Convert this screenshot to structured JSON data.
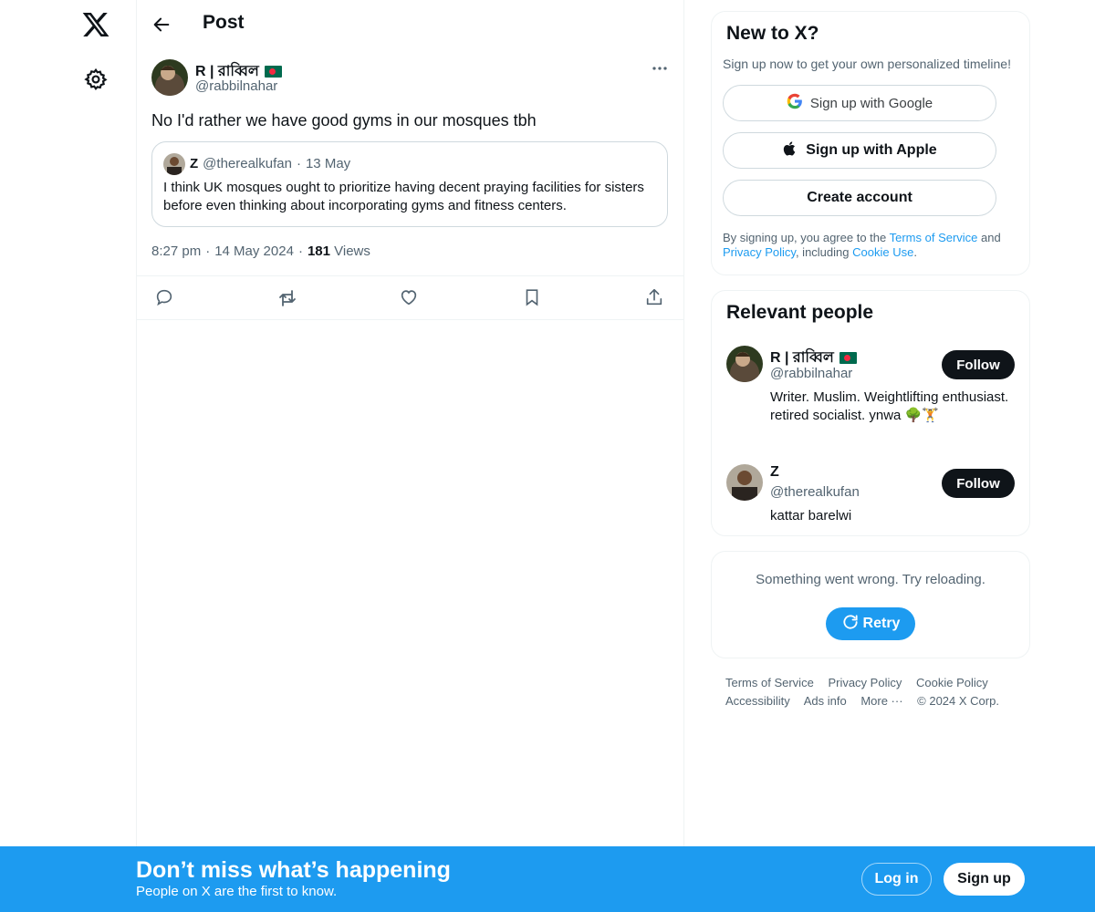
{
  "nav": {
    "logo_icon": "x-logo-icon",
    "settings_icon": "gear-icon"
  },
  "header": {
    "title": "Post",
    "back_icon": "arrow-left-icon"
  },
  "post": {
    "author_name": "R | রাব্বিল",
    "author_handle": "@rabbilnahar",
    "text": "No I'd rather we have good gyms in our mosques tbh",
    "quote": {
      "author_name": "Z",
      "author_handle": "@therealkufan",
      "separator": "·",
      "date": "13 May",
      "text": "I think UK mosques ought to prioritize having decent praying facilities for sisters before even thinking about incorporating gyms and fitness centers."
    },
    "time": "8:27 pm",
    "separator": "·",
    "date": "14 May 2024",
    "views_count": "181",
    "views_label": "Views"
  },
  "signup_card": {
    "title": "New to X?",
    "subtitle": "Sign up now to get your own personalized timeline!",
    "google_label": "Sign up with Google",
    "apple_label": "Sign up with Apple",
    "create_label": "Create account",
    "legal_prefix": "By signing up, you agree to the ",
    "terms_label": "Terms of Service",
    "legal_and": " and ",
    "privacy_label": "Privacy Policy",
    "legal_including": ", including ",
    "cookie_label": "Cookie Use",
    "legal_end": "."
  },
  "relevant": {
    "title": "Relevant people",
    "people": [
      {
        "name": "R | রাব্বিল",
        "handle": "@rabbilnahar",
        "bio": "Writer. Muslim. Weightlifting enthusiast. retired socialist. ynwa 🌳🏋",
        "follow_label": "Follow"
      },
      {
        "name": "Z",
        "handle": "@therealkufan",
        "bio": "kattar barelwi",
        "follow_label": "Follow"
      }
    ]
  },
  "error_card": {
    "message": "Something went wrong. Try reloading.",
    "retry_label": "Retry"
  },
  "footer": {
    "links": [
      "Terms of Service",
      "Privacy Policy",
      "Cookie Policy",
      "Accessibility",
      "Ads info",
      "More ···",
      "© 2024 X Corp."
    ]
  },
  "bottom_bar": {
    "title": "Don’t miss what’s happening",
    "subtitle": "People on X are the first to know.",
    "login_label": "Log in",
    "signup_label": "Sign up"
  },
  "colors": {
    "accent": "#1d9bf0",
    "text": "#0f1419",
    "secondary": "#536471",
    "border": "#cfd9de"
  }
}
